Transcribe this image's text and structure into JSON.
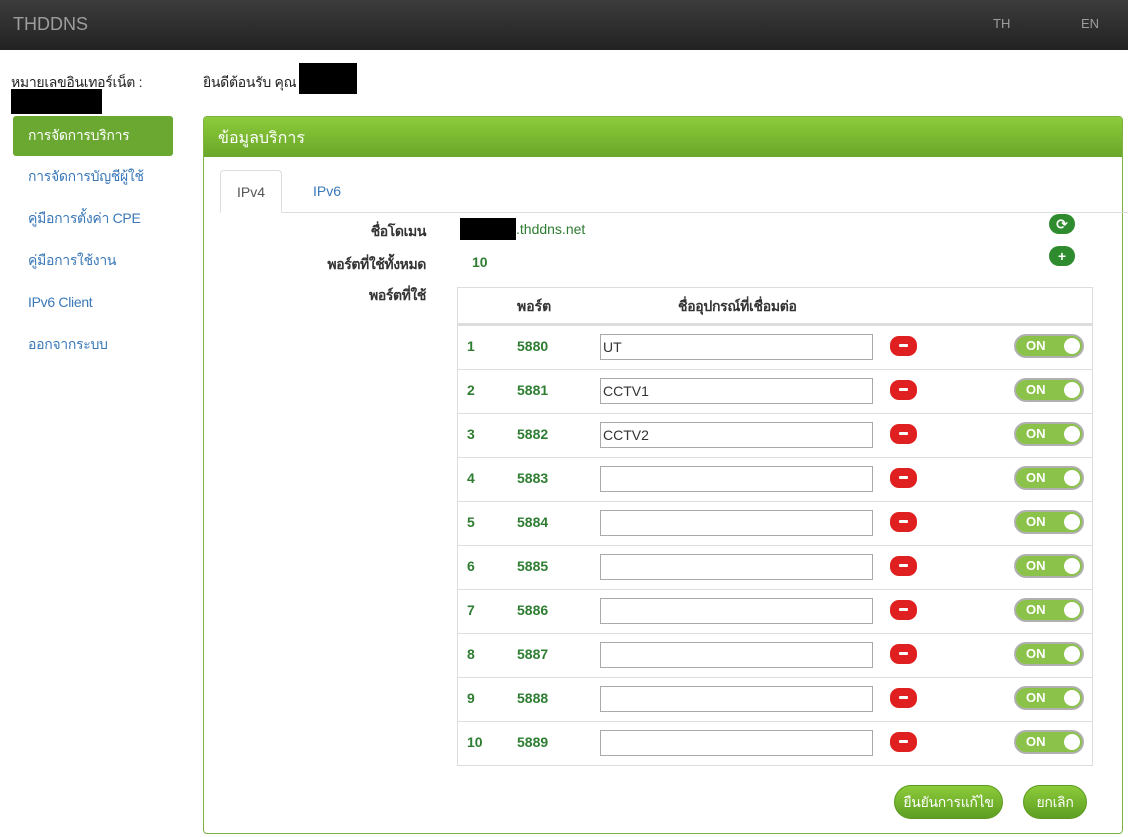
{
  "navbar": {
    "brand": "THDDNS",
    "lang_th": "TH",
    "lang_en": "EN"
  },
  "sidebar": {
    "account_label": "หมายเลขอินเทอร์เน็ต :",
    "items": [
      {
        "label": "การจัดการบริการ",
        "active": true
      },
      {
        "label": "การจัดการบัญชีผู้ใช้"
      },
      {
        "label": "คู่มือการตั้งค่า CPE"
      },
      {
        "label": "คู่มือการใช้งาน"
      },
      {
        "label": "IPv6 Client"
      },
      {
        "label": "ออกจากระบบ"
      }
    ]
  },
  "welcome": "ยินดีต้อนรับ คุณ",
  "panel": {
    "title": "ข้อมูลบริการ",
    "tabs": [
      "IPv4",
      "IPv6"
    ],
    "domain_label": "ชื่อโดเมน",
    "domain_suffix": ".thddns.net",
    "total_ports_label": "พอร์ตที่ใช้ทั้งหมด",
    "total_ports": "10",
    "used_ports_label": "พอร์ตที่ใช้",
    "table_headers": {
      "port": "พอร์ต",
      "device": "ชื่ออุปกรณ์ที่เชื่อมต่อ"
    },
    "rows": [
      {
        "num": "1",
        "port": "5880",
        "device": "UT",
        "state": "ON"
      },
      {
        "num": "2",
        "port": "5881",
        "device": "CCTV1",
        "state": "ON"
      },
      {
        "num": "3",
        "port": "5882",
        "device": "CCTV2",
        "state": "ON"
      },
      {
        "num": "4",
        "port": "5883",
        "device": "",
        "state": "ON"
      },
      {
        "num": "5",
        "port": "5884",
        "device": "",
        "state": "ON"
      },
      {
        "num": "6",
        "port": "5885",
        "device": "",
        "state": "ON"
      },
      {
        "num": "7",
        "port": "5886",
        "device": "",
        "state": "ON"
      },
      {
        "num": "8",
        "port": "5887",
        "device": "",
        "state": "ON"
      },
      {
        "num": "9",
        "port": "5888",
        "device": "",
        "state": "ON"
      },
      {
        "num": "10",
        "port": "5889",
        "device": "",
        "state": "ON"
      }
    ],
    "confirm_label": "ยืนยันการแก้ไข",
    "cancel_label": "ยกเลิก"
  },
  "colors": {
    "accent_green": "#6aa832",
    "port_text": "#2e7d32",
    "remove_red": "#e02020",
    "link_blue": "#3a78b8"
  },
  "icons": {
    "refresh": "refresh-icon",
    "add": "plus-icon",
    "remove": "minus-icon"
  }
}
